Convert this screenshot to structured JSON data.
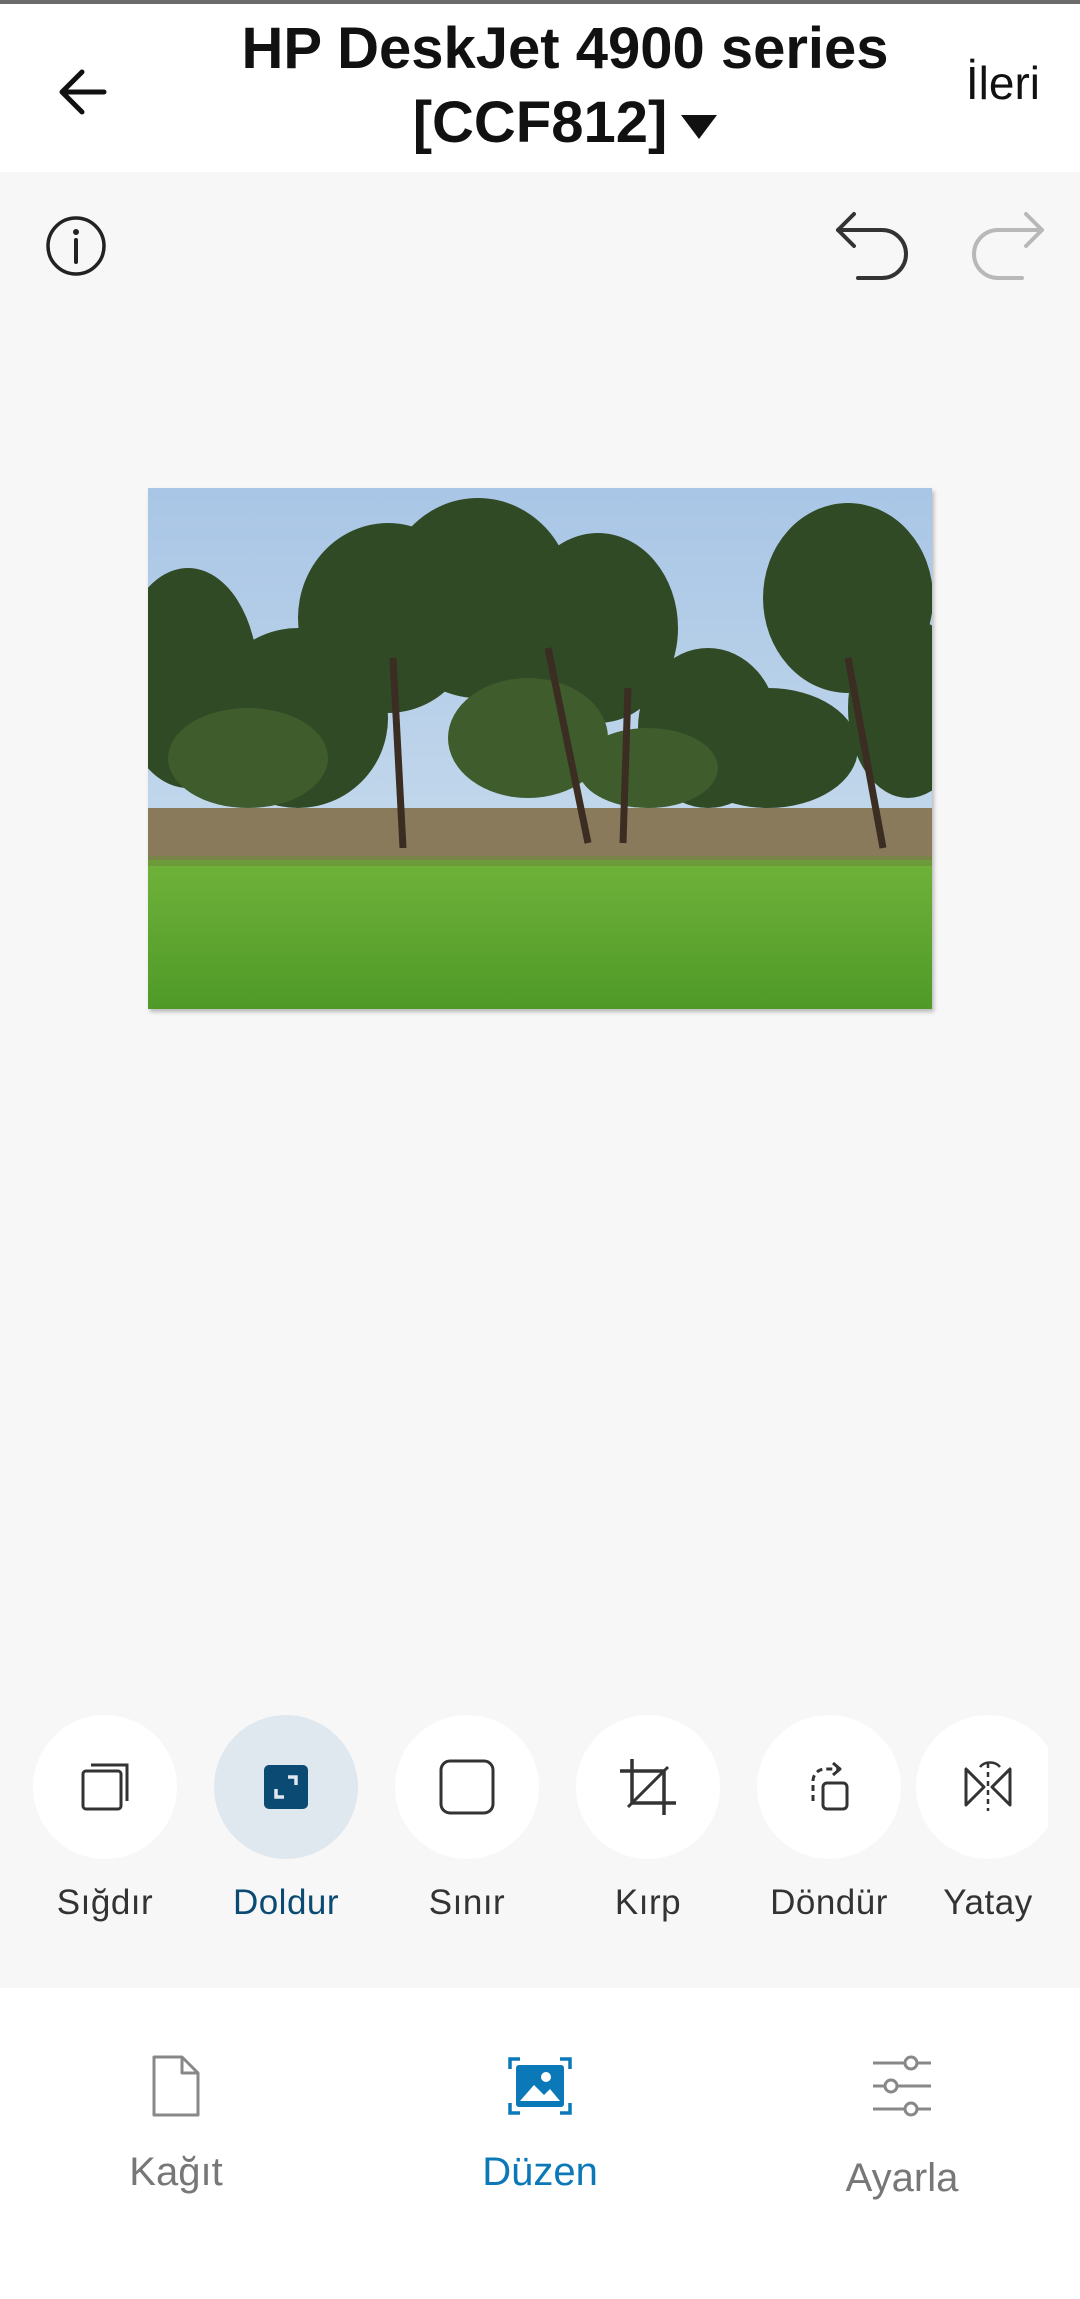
{
  "header": {
    "title_line1": "HP DeskJet 4900 series",
    "title_line2": "[CCF812]",
    "next_label": "İleri"
  },
  "edit_tools": [
    {
      "label": "Sığdır",
      "icon": "fit-icon",
      "active": false
    },
    {
      "label": "Doldur",
      "icon": "fill-icon",
      "active": true
    },
    {
      "label": "Sınır",
      "icon": "border-icon",
      "active": false
    },
    {
      "label": "Kırp",
      "icon": "crop-icon",
      "active": false
    },
    {
      "label": "Döndür",
      "icon": "rotate-icon",
      "active": false
    },
    {
      "label": "Yatay",
      "icon": "flip-horizontal-icon",
      "active": false
    }
  ],
  "bottom_nav": [
    {
      "label": "Kağıt",
      "icon": "paper-icon",
      "active": false
    },
    {
      "label": "Düzen",
      "icon": "layout-image-icon",
      "active": true
    },
    {
      "label": "Ayarla",
      "icon": "adjust-sliders-icon",
      "active": false
    }
  ],
  "colors": {
    "accent": "#0b78b8",
    "active_tool_bg": "#dfe8ef",
    "active_tool_icon": "#0a4a73",
    "background": "#f7f7f7"
  }
}
